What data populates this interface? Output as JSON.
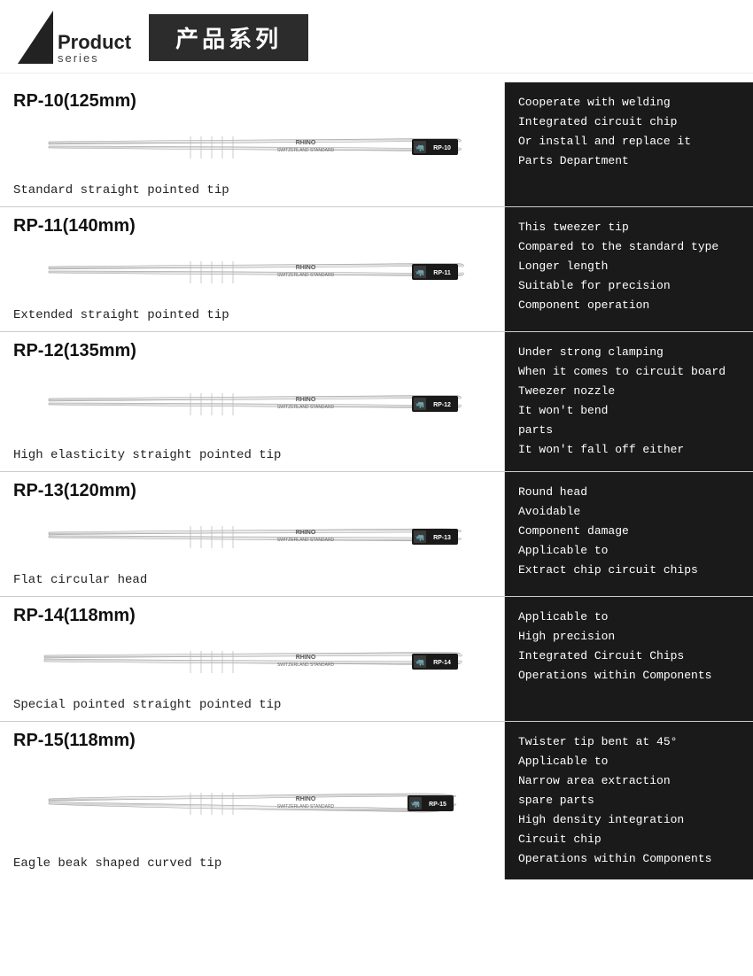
{
  "header": {
    "product_bold": "Product",
    "product_small": "series",
    "chinese_title": "产品系列"
  },
  "products": [
    {
      "model": "RP-10(125mm)",
      "caption": "Standard straight pointed tip",
      "description": "Cooperate with welding\nIntegrated circuit chip\nOr install and replace it\nParts Department",
      "tip_type": "straight",
      "label": "RP-10"
    },
    {
      "model": "RP-11(140mm)",
      "caption": "Extended straight pointed tip",
      "description": "This tweezer tip\nCompared to the standard type\nLonger length\nSuitable for precision\nComponent operation",
      "tip_type": "straight_long",
      "label": "RP-11"
    },
    {
      "model": "RP-12(135mm)",
      "caption": "High elasticity straight pointed tip",
      "description": "Under strong clamping\nWhen it comes to circuit board\nTweezer nozzle\nIt won't bend\nparts\nIt won't fall off either",
      "tip_type": "straight",
      "label": "RP-12"
    },
    {
      "model": "RP-13(120mm)",
      "caption": "Flat circular head",
      "description": "Round head\nAvoidable\nComponent damage\nApplicable to\nExtract chip circuit chips",
      "tip_type": "flat_head",
      "label": "RP-13"
    },
    {
      "model": "RP-14(118mm)",
      "caption": "Special pointed straight pointed tip",
      "description": "Applicable to\nHigh precision\nIntegrated Circuit Chips\nOperations within Components",
      "tip_type": "angled",
      "label": "RP-14"
    },
    {
      "model": "RP-15(118mm)",
      "caption": "Eagle beak shaped curved tip",
      "description": "Twister tip bent at 45°\nApplicable to\nNarrow area extraction\nspare parts\nHigh density integration\nCircuit chip\nOperations within Components",
      "tip_type": "curved",
      "label": "RP-15"
    }
  ]
}
